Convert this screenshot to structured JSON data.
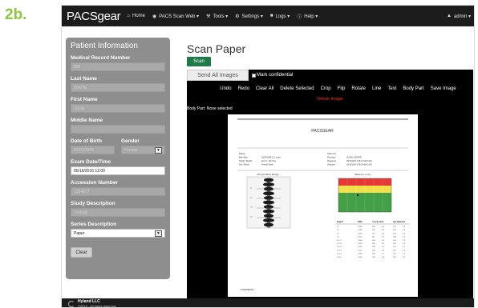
{
  "figure_label": "2b.",
  "navbar": {
    "brand": "PACSgear",
    "items": [
      {
        "icon": "home-icon",
        "glyph": "⌂",
        "label": "Home"
      },
      {
        "icon": "camera-icon",
        "glyph": "◉",
        "label": "PACS Scan Web ▾"
      },
      {
        "icon": "wrench-icon",
        "glyph": "⚒",
        "label": "Tools ▾"
      },
      {
        "icon": "gear-icon",
        "glyph": "⚙",
        "label": "Settings ▾"
      },
      {
        "icon": "book-icon",
        "glyph": "■",
        "label": "Logs ▾"
      },
      {
        "icon": "help-icon",
        "glyph": "ⓘ",
        "label": "Help ▾"
      }
    ],
    "user": {
      "icon": "user-icon",
      "glyph": "▲",
      "label": "admin ▾"
    }
  },
  "sidebar": {
    "title": "Patient Information",
    "fields": {
      "mrn": {
        "label": "Medical Record Number",
        "value": "898"
      },
      "last_name": {
        "label": "Last Name",
        "value": "WHITE"
      },
      "first_name": {
        "label": "First Name",
        "value": "JULIE"
      },
      "middle_name": {
        "label": "Middle Name",
        "value": ""
      },
      "dob": {
        "label": "Date of Birth",
        "value": "01/01/1945"
      },
      "gender": {
        "label": "Gender",
        "value": "Female"
      },
      "exam_date": {
        "label": "Exam Date/Time",
        "value": "05/16/2016 12:00"
      },
      "accession": {
        "label": "Accession Number",
        "value": "1284577"
      },
      "study": {
        "label": "Study Description",
        "value": "Urology"
      },
      "series": {
        "label": "Series Description",
        "value": "Paper"
      }
    },
    "clear_label": "Clear"
  },
  "main": {
    "title": "Scan Paper",
    "scan_label": "Scan",
    "send_all_label": "Send All Images",
    "confidential_label": "Mark confidential"
  },
  "viewer": {
    "tools": [
      "Undo",
      "Redo",
      "Clear All",
      "Delete Selected",
      "Crop",
      "Flip",
      "Rotate",
      "Line",
      "Text",
      "Body Part",
      "Save Image"
    ],
    "delete_image_label": "Delete Image",
    "body_part_status": "Body Part: None selected",
    "colors": {
      "delete": "#ff2a2a",
      "scan_button": "#1e7a47",
      "sidebar_bg": "#8e8e8e",
      "figure_label": "#8cc63f"
    }
  },
  "document": {
    "header": "PACSGEAR",
    "demo_left": [
      "Patient:",
      "Birth Date:",
      "Height / Weight:",
      "Sex / Ethnic:"
    ],
    "demo_left_vals": [
      "",
      "05/20/1945   61.1 years",
      "62.0 in.   134.0 lbs",
      "Female   White"
    ],
    "demo_right": [
      "Patient ID:",
      "Physician:",
      "Measured:",
      "Analyzed:"
    ],
    "demo_right_vals": [
      "",
      "SLOAN CARTER",
      "05/16/2016   4:38:14 AM  (3.60)",
      "05/16/2016   4:38:14 AM  (3.60)"
    ],
    "spine_caption": "AP Spine Bone Density",
    "ref_caption": "Reference: L1-L4",
    "region_labels": [
      "L1",
      "L2",
      "L3",
      "L4"
    ],
    "table_headers": [
      "Region",
      "BMD",
      "Young-Adult",
      "Age-Matched"
    ],
    "table_rows": [
      [
        "L1",
        "1.008",
        "104",
        "0.5",
        "123",
        "1.8"
      ],
      [
        "L2",
        "1.009",
        "105",
        "0.4",
        "124",
        "1.9"
      ],
      [
        "L3",
        "1.024",
        "107",
        "0.6",
        "126",
        "2.0"
      ],
      [
        "L4",
        "1.072",
        "111",
        "1.0",
        "130",
        "2.4"
      ],
      [
        "L1-L2",
        "1.008",
        "105",
        "0.4",
        "124",
        "1.9"
      ],
      [
        "L1-L3",
        "1.014",
        "106",
        "0.5",
        "125",
        "1.9"
      ],
      [
        "L1-L4",
        "1.032",
        "108",
        "0.7",
        "127",
        "2.1"
      ],
      [
        "L2-L3",
        "1.017",
        "106",
        "0.5",
        "125",
        "2.0"
      ],
      [
        "L2-L4",
        "1.038",
        "108",
        "0.7",
        "127",
        "2.2"
      ],
      [
        "L3-L4",
        "1.048",
        "109",
        "0.8",
        "128",
        "2.2"
      ]
    ],
    "comments_label": "COMMENTS:"
  },
  "footer": {
    "company": "Hyland LLC",
    "copyright": "©2013 - All rights reserved."
  }
}
